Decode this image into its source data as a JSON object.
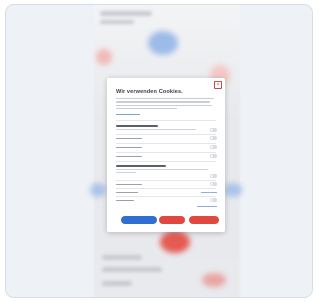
{
  "dialog": {
    "title": "Wir verwenden Cookies.",
    "close_glyph": "×"
  },
  "colors": {
    "primary_button": "#2f6fd1",
    "reject_button": "#e0473f",
    "toggle_on": "#4c86d6",
    "toggle_off": "#d9dce1"
  },
  "icons": {
    "close": "close-icon"
  },
  "sections": [
    {
      "toggles": [
        "off",
        "off",
        "off"
      ]
    },
    {
      "toggles": [
        "off",
        "off",
        "off"
      ]
    }
  ]
}
